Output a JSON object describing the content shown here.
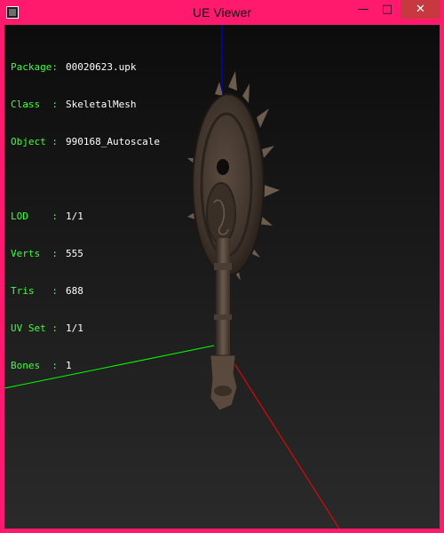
{
  "window": {
    "title": "UE Viewer",
    "minimize_glyph": "—",
    "maximize_glyph": "□",
    "close_glyph": "✕"
  },
  "info": {
    "package_label": "Package:",
    "package_value": "00020623.upk",
    "class_label": "Class  :",
    "class_value": "SkeletalMesh",
    "object_label": "Object :",
    "object_value": "990168_Autoscale",
    "lod_label": "LOD    :",
    "lod_value": "1/1",
    "verts_label": "Verts  :",
    "verts_value": "555",
    "tris_label": "Tris   :",
    "tris_value": "688",
    "uvset_label": "UV Set :",
    "uvset_value": "1/1",
    "bones_label": "Bones  :",
    "bones_value": "1"
  },
  "colors": {
    "frame": "#ff1a6e",
    "axis_x": "#ff0000",
    "axis_y": "#00ff00",
    "axis_z": "#0000ff",
    "info_text": "#3cff3c"
  }
}
